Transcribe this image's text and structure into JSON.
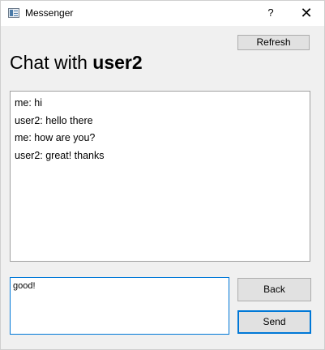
{
  "window": {
    "title": "Messenger",
    "help_label": "?",
    "close_label": "✕"
  },
  "toolbar": {
    "refresh_label": "Refresh"
  },
  "header": {
    "prefix": "Chat with ",
    "username": "user2"
  },
  "chat": {
    "messages": [
      "me: hi",
      "user2: hello there",
      "me: how are you?",
      "user2: great! thanks"
    ]
  },
  "composer": {
    "value": "good!",
    "back_label": "Back",
    "send_label": "Send"
  },
  "colors": {
    "accent": "#0078d7",
    "button_bg": "#e1e1e1",
    "window_bg": "#f0f0f0"
  }
}
